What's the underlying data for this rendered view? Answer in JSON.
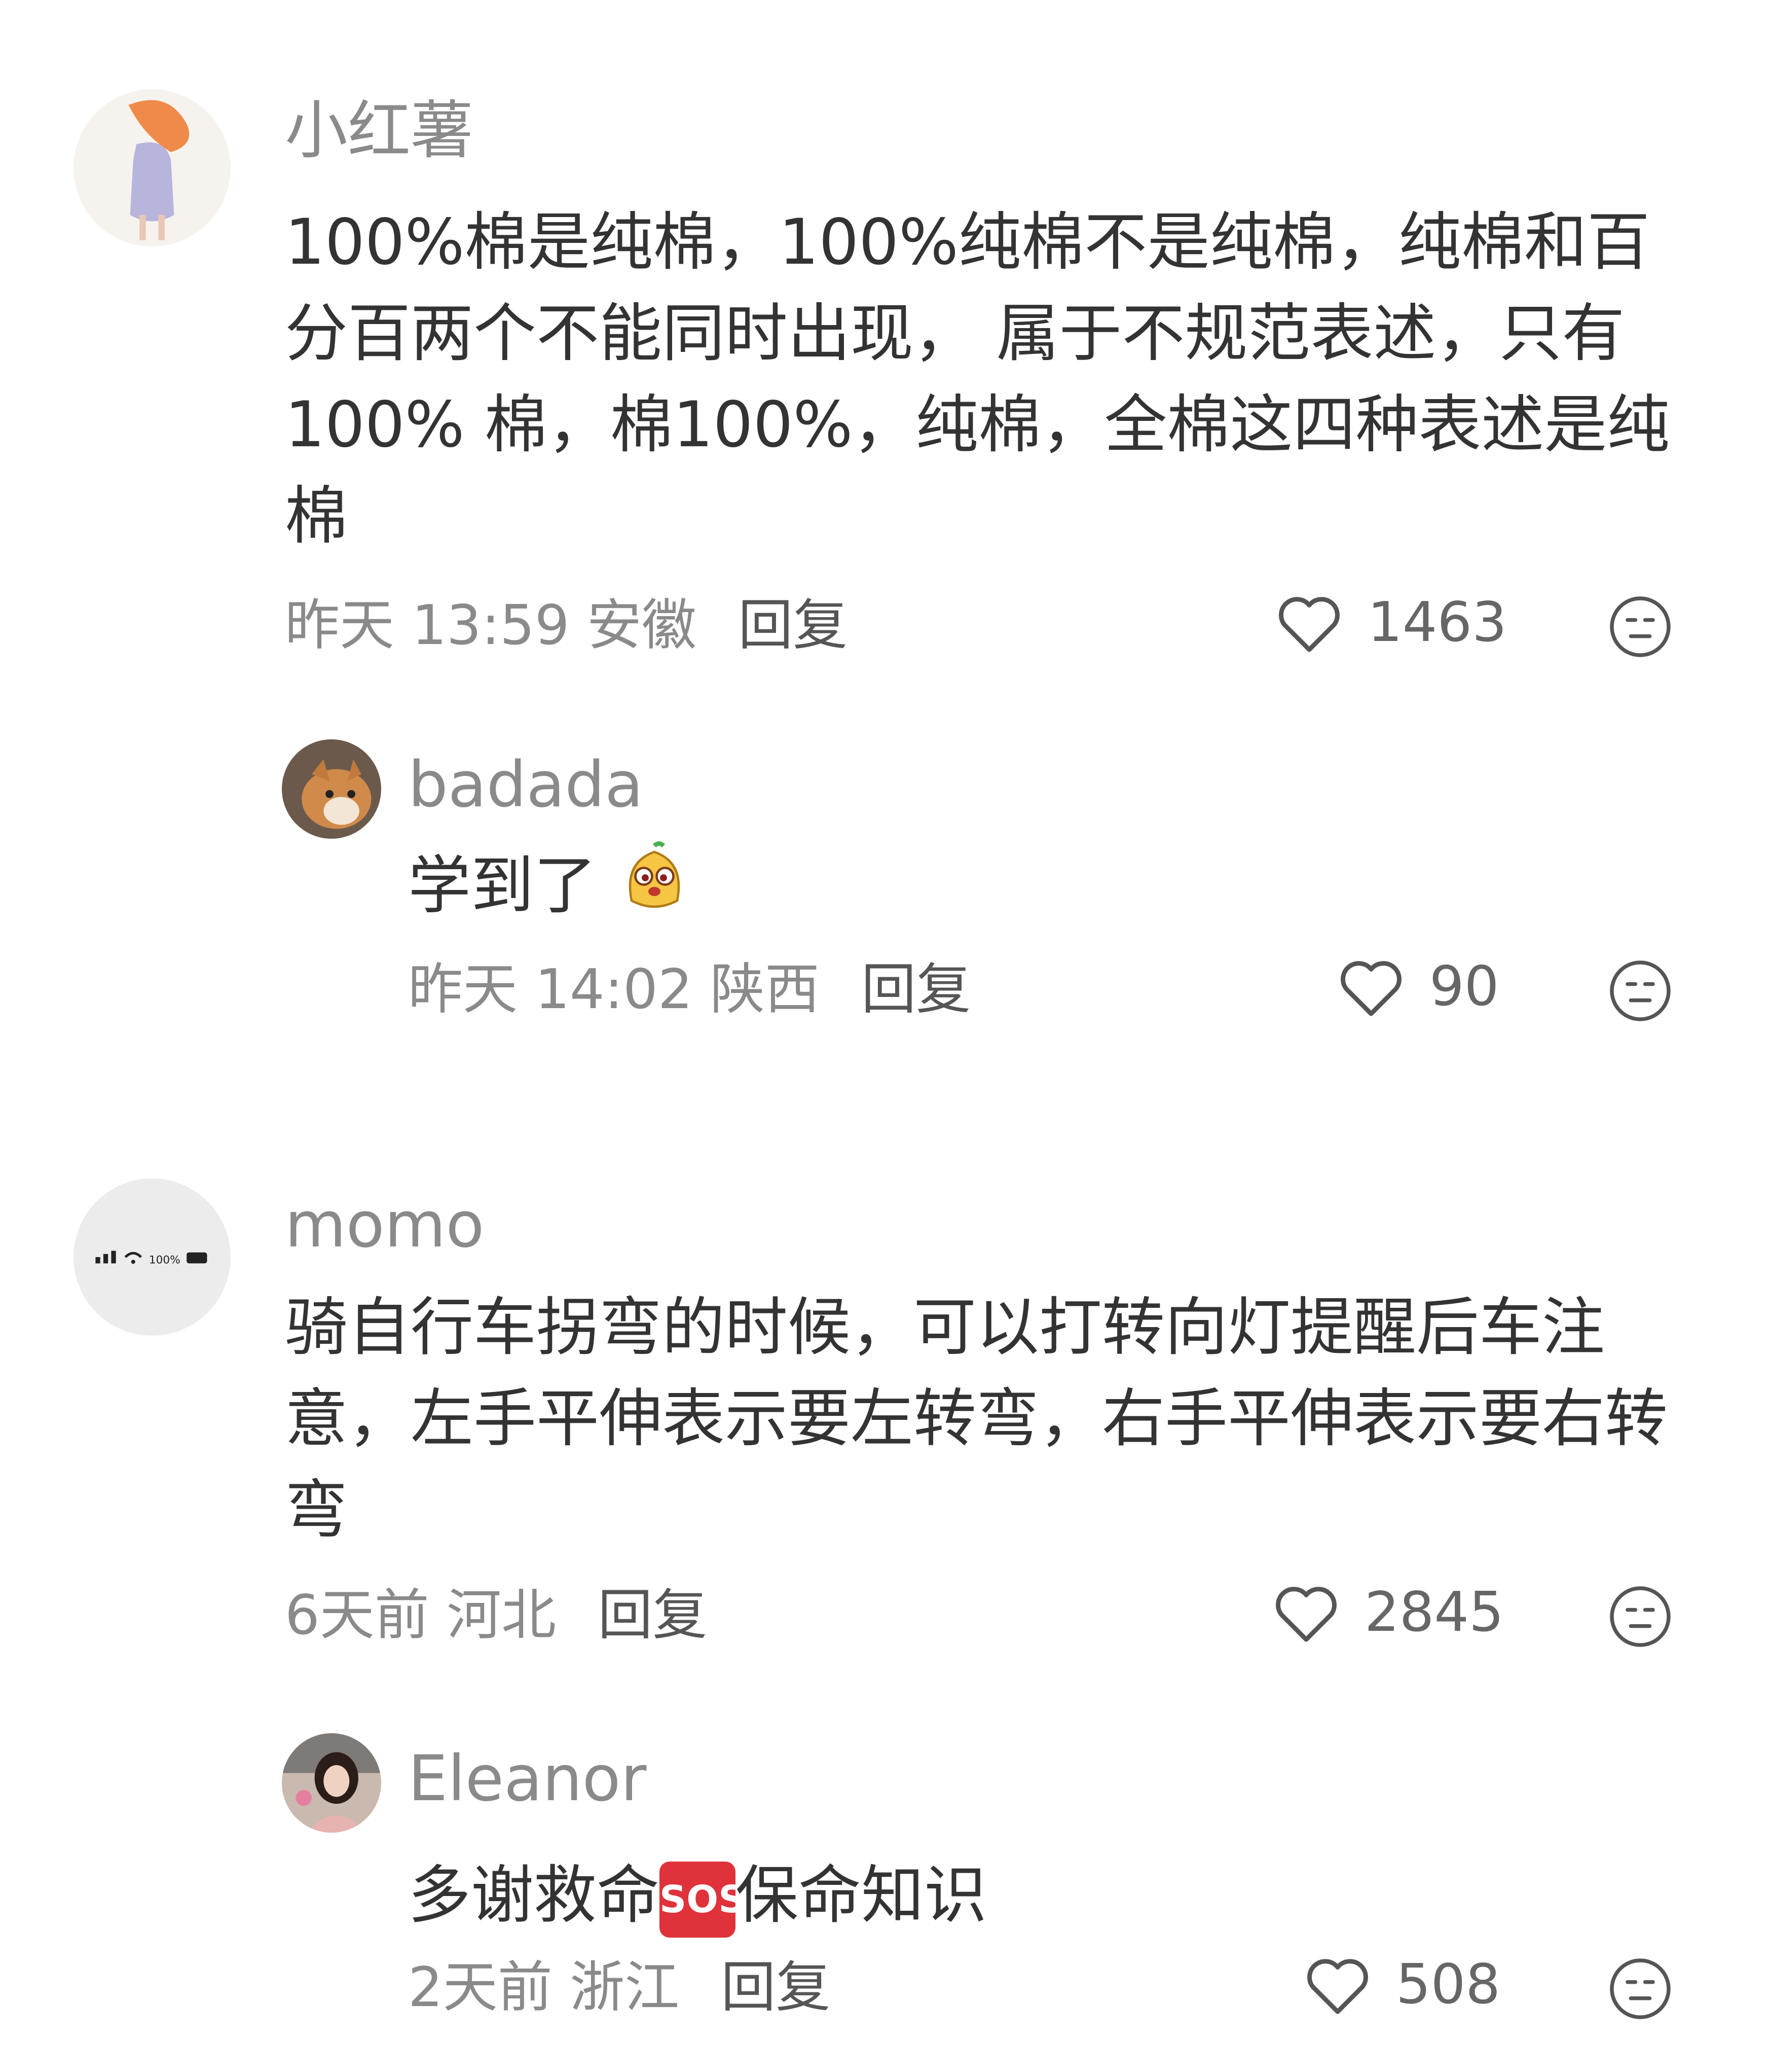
{
  "comments": [
    {
      "username": "小红薯",
      "text": "100%棉是纯棉，100%纯棉不是纯棉，纯棉和百分百两个不能同时出现， 属于不规范表述，只有100% 棉，棉100%，纯棉，全棉这四种表述是纯棉",
      "time": "昨天 13:59",
      "location": "安徽",
      "reply_label": "回复",
      "likes": "1463",
      "replies": [
        {
          "username": "badada",
          "text": "学到了",
          "emoji": "cute-face-emoji",
          "time": "昨天 14:02",
          "location": "陕西",
          "reply_label": "回复",
          "likes": "90"
        }
      ]
    },
    {
      "username": "momo",
      "text": "骑自行车拐弯的时候，可以打转向灯提醒后车注意，左手平伸表示要左转弯，右手平伸表示要右转弯",
      "time": "6天前",
      "location": "河北",
      "reply_label": "回复",
      "likes": "2845",
      "avatar_text": "100%",
      "replies": [
        {
          "username": "Eleanor",
          "text_before": "多谢救命",
          "sos_label": "SOS",
          "text_after": "保命知识",
          "time": "2天前",
          "location": "浙江",
          "reply_label": "回复",
          "likes": "508"
        }
      ]
    }
  ],
  "colors": {
    "text": "#333333",
    "meta": "#8a8a8a",
    "icon": "#555555",
    "sos": "#e0323a"
  },
  "icons": {
    "like": "heart-outline-icon",
    "dislike": "neutral-face-icon"
  }
}
